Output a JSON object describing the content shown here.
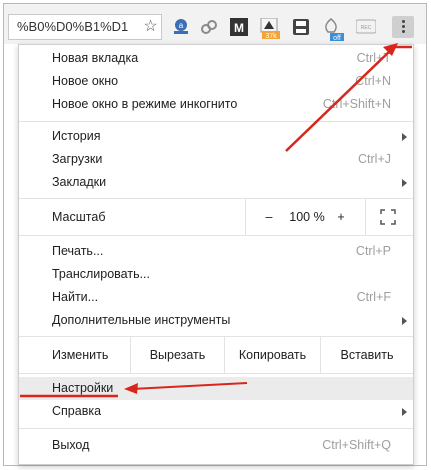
{
  "toolbar": {
    "url_text": "%B0%D0%B1%D1",
    "star_glyph": "☆",
    "extensions": [
      {
        "name": "shopping-ext-icon",
        "color": "#3b6fb5"
      },
      {
        "name": "link-ext-icon",
        "color": "#8a8a8a"
      },
      {
        "name": "m-ext-icon",
        "color": "#333333",
        "letter": "M"
      },
      {
        "name": "downloader-ext-icon",
        "color": "#f2a33a",
        "badge": "37k"
      },
      {
        "name": "save-ext-icon",
        "color": "#444444"
      },
      {
        "name": "off-ext-icon",
        "color": "#888888",
        "badge": "off"
      },
      {
        "name": "rec-ext-icon",
        "color": "#999999",
        "letter": "REC"
      }
    ]
  },
  "menu": {
    "group1": [
      {
        "label": "Новая вкладка",
        "shortcut": "Ctrl+T"
      },
      {
        "label": "Новое окно",
        "shortcut": "Ctrl+N"
      },
      {
        "label": "Новое окно в режиме инкогнито",
        "shortcut": "Ctrl+Shift+N"
      }
    ],
    "group2": [
      {
        "label": "История",
        "shortcut": "",
        "submenu": true
      },
      {
        "label": "Загрузки",
        "shortcut": "Ctrl+J",
        "submenu": false
      },
      {
        "label": "Закладки",
        "shortcut": "",
        "submenu": true
      }
    ],
    "zoom": {
      "label": "Масштаб",
      "minus": "–",
      "value": "100 %",
      "plus": "+"
    },
    "group3": [
      {
        "label": "Печать...",
        "shortcut": "Ctrl+P",
        "submenu": false
      },
      {
        "label": "Транслировать...",
        "shortcut": "",
        "submenu": false
      },
      {
        "label": "Найти...",
        "shortcut": "Ctrl+F",
        "submenu": false
      },
      {
        "label": "Дополнительные инструменты",
        "shortcut": "",
        "submenu": true
      }
    ],
    "edit": {
      "label": "Изменить",
      "cut": "Вырезать",
      "copy": "Копировать",
      "paste": "Вставить"
    },
    "group4": [
      {
        "label": "Настройки",
        "shortcut": "",
        "submenu": false,
        "highlighted": true
      },
      {
        "label": "Справка",
        "shortcut": "",
        "submenu": true
      }
    ],
    "group5": [
      {
        "label": "Выход",
        "shortcut": "Ctrl+Shift+Q",
        "submenu": false
      }
    ]
  },
  "annotations": {
    "arrow_color": "#d9261c"
  }
}
